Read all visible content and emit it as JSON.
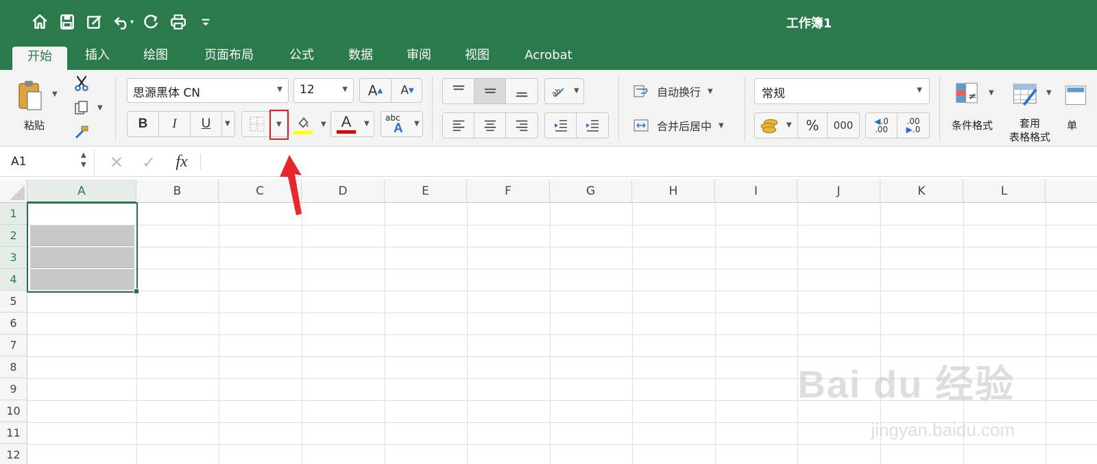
{
  "window": {
    "title": "工作簿1"
  },
  "quick_access": [
    {
      "name": "home-icon"
    },
    {
      "name": "save-icon"
    },
    {
      "name": "edit-icon"
    },
    {
      "name": "undo-icon"
    },
    {
      "name": "redo-icon"
    },
    {
      "name": "print-icon"
    },
    {
      "name": "customize-icon"
    }
  ],
  "tabs": [
    {
      "label": "开始",
      "active": true
    },
    {
      "label": "插入"
    },
    {
      "label": "绘图"
    },
    {
      "label": "页面布局"
    },
    {
      "label": "公式"
    },
    {
      "label": "数据"
    },
    {
      "label": "审阅"
    },
    {
      "label": "视图"
    },
    {
      "label": "Acrobat"
    }
  ],
  "ribbon": {
    "paste_label": "粘贴",
    "font_name": "思源黑体 CN",
    "font_size": "12",
    "bold": "B",
    "italic": "I",
    "underline": "U",
    "grow_font": "A",
    "shrink_font": "A",
    "font_color_glyph": "A",
    "phonetic_top": "abc",
    "phonetic_bottom": "A",
    "wrap_text": "自动换行",
    "merge_center": "合并后居中",
    "number_format": "常规",
    "percent": "%",
    "comma": "000",
    "inc_decimal_top": ".0",
    "inc_decimal_bottom": ".00",
    "dec_decimal_top": ".00",
    "dec_decimal_bottom": ".0",
    "conditional_format": "条件格式",
    "table_format_line1": "套用",
    "table_format_line2": "表格格式",
    "cell_styles_partial": "单",
    "fill_color": "#ffff00",
    "font_color": "#e00000",
    "highlight_box_color": "#e02020"
  },
  "formula_bar": {
    "name_box": "A1",
    "fx": "fx"
  },
  "sheet": {
    "columns": [
      "A",
      "B",
      "C",
      "D",
      "E",
      "F",
      "G",
      "H",
      "I",
      "J",
      "K",
      "L"
    ],
    "rows": [
      "1",
      "2",
      "3",
      "4",
      "5",
      "6",
      "7",
      "8",
      "9",
      "10",
      "11",
      "12"
    ],
    "active_cell": "A1",
    "selection": "A1:A4",
    "shaded_range": "A2:A4"
  },
  "watermark": {
    "main": "Bai du 经验",
    "sub": "jingyan.baidu.com"
  }
}
